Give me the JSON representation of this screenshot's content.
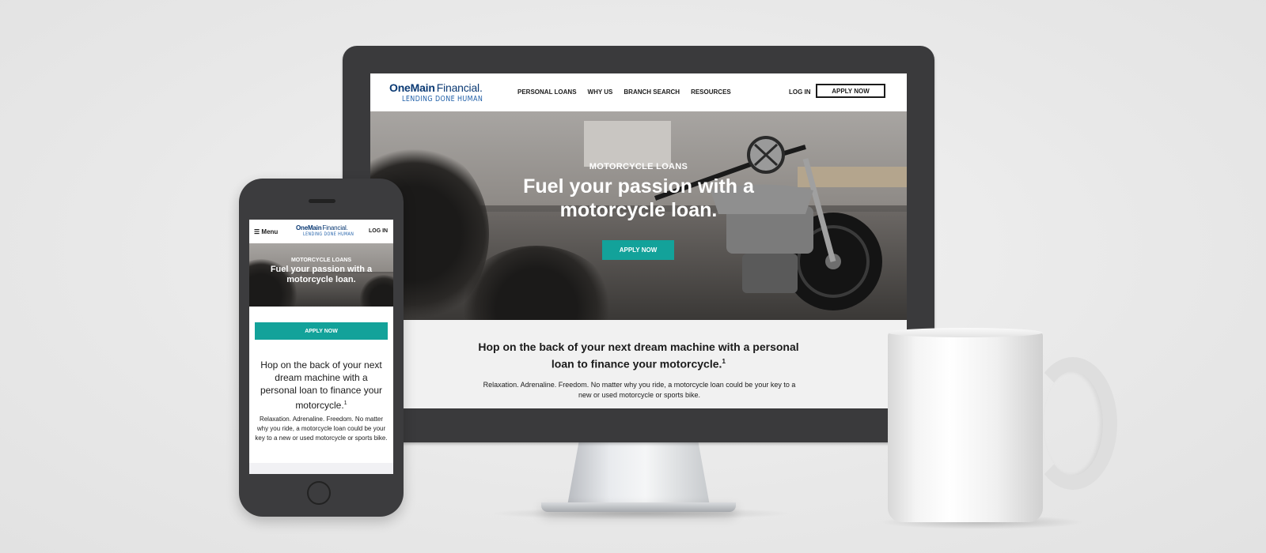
{
  "brand": {
    "name_bold": "OneMain",
    "name_light": "Financial.",
    "tagline": "LENDING DONE HUMAN"
  },
  "desktop": {
    "nav": [
      "PERSONAL LOANS",
      "WHY US",
      "BRANCH SEARCH",
      "RESOURCES"
    ],
    "login": "LOG IN",
    "apply_now_header": "APPLY NOW",
    "hero": {
      "eyebrow": "MOTORCYCLE LOANS",
      "title": "Fuel your passion with a motorcycle loan.",
      "button": "APPLY NOW"
    },
    "content": {
      "heading": "Hop on the back of your next dream machine with a personal loan to finance your motorcycle.",
      "footnote": "1",
      "body": "Relaxation. Adrenaline. Freedom. No matter why you ride, a motorcycle loan could be your key to a new or used motorcycle or sports bike."
    }
  },
  "mobile": {
    "menu_icon": "hamburger-icon",
    "menu": "Menu",
    "login": "LOG IN",
    "hero": {
      "eyebrow": "MOTORCYCLE LOANS",
      "title": "Fuel your passion with a motorcycle loan."
    },
    "apply_now": "APPLY NOW",
    "content": {
      "heading": "Hop on the back of your next dream machine with a personal loan to finance your motorcycle.",
      "footnote": "1",
      "body": "Relaxation. Adrenaline. Freedom. No matter why you ride, a motorcycle loan could be your key to a new or used motorcycle or sports bike."
    }
  },
  "colors": {
    "brand_navy": "#0b3a74",
    "accent_teal": "#13a29a",
    "device_body": "#3a3a3c",
    "content_bg": "#f1f1f1"
  }
}
